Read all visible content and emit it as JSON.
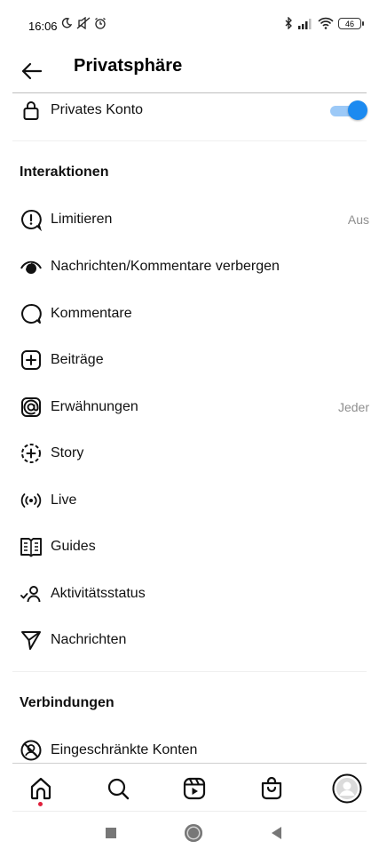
{
  "status_bar": {
    "time": "16:06",
    "battery": "46"
  },
  "header": {
    "title": "Privatsphäre"
  },
  "account": {
    "private_label": "Privates Konto",
    "private_enabled": true
  },
  "interactions": {
    "heading": "Interaktionen",
    "items": [
      {
        "label": "Limitieren",
        "value": "Aus",
        "icon": "limit-icon"
      },
      {
        "label": "Nachrichten/Kommentare verbergen",
        "value": "",
        "icon": "hide-icon"
      },
      {
        "label": "Kommentare",
        "value": "",
        "icon": "comment-icon"
      },
      {
        "label": "Beiträge",
        "value": "",
        "icon": "plus-square-icon"
      },
      {
        "label": "Erwähnungen",
        "value": "Jeder",
        "icon": "mention-icon"
      },
      {
        "label": "Story",
        "value": "",
        "icon": "story-icon"
      },
      {
        "label": "Live",
        "value": "",
        "icon": "live-icon"
      },
      {
        "label": "Guides",
        "value": "",
        "icon": "guides-icon"
      },
      {
        "label": "Aktivitätsstatus",
        "value": "",
        "icon": "activity-icon"
      },
      {
        "label": "Nachrichten",
        "value": "",
        "icon": "send-icon"
      }
    ]
  },
  "connections": {
    "heading": "Verbindungen",
    "items": [
      {
        "label": "Eingeschränkte Konten",
        "icon": "restricted-icon"
      }
    ]
  },
  "bottom_nav": [
    "home-icon",
    "search-icon",
    "reels-icon",
    "shop-icon",
    "profile-avatar"
  ],
  "colors": {
    "accent": "#1c8af0",
    "notification_dot": "#e0203b"
  }
}
